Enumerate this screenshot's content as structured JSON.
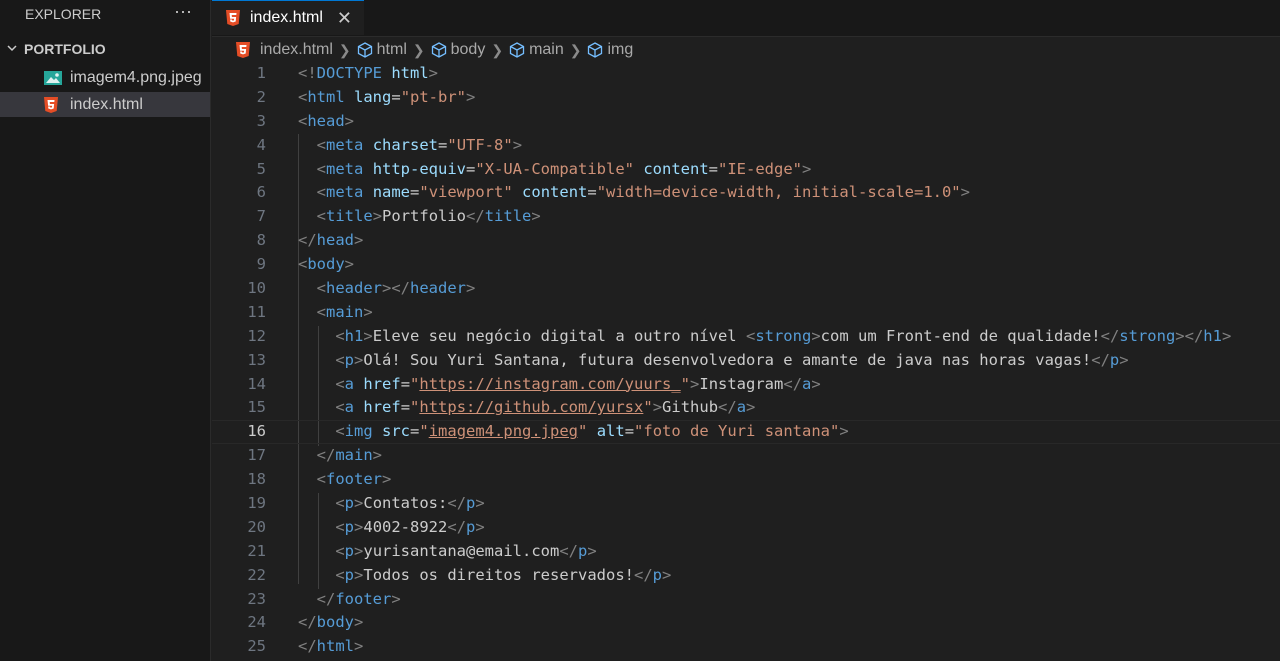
{
  "sidebar": {
    "title": "EXPLORER",
    "more": "···",
    "folder": "PORTFOLIO",
    "files": [
      {
        "name": "imagem4.png.jpeg",
        "icon": "image-file-icon"
      },
      {
        "name": "index.html",
        "icon": "html5-icon",
        "selected": true
      }
    ]
  },
  "tab": {
    "label": "index.html",
    "close": "✕"
  },
  "breadcrumb": [
    "index.html",
    "html",
    "body",
    "main",
    "img"
  ],
  "editor": {
    "current_line": 16,
    "lines": [
      [
        [
          "t-br",
          "<!"
        ],
        [
          "t-tag",
          "DOCTYPE"
        ],
        [
          "t-txt",
          " "
        ],
        [
          "t-attr",
          "html"
        ],
        [
          "t-br",
          ">"
        ]
      ],
      [
        [
          "t-br",
          "<"
        ],
        [
          "t-tag",
          "html"
        ],
        [
          "t-txt",
          " "
        ],
        [
          "t-attr",
          "lang"
        ],
        [
          "t-txt",
          "="
        ],
        [
          "t-str",
          "\"pt-br\""
        ],
        [
          "t-br",
          ">"
        ]
      ],
      [
        [
          "t-br",
          "<"
        ],
        [
          "t-tag",
          "head"
        ],
        [
          "t-br",
          ">"
        ]
      ],
      [
        [
          "t-txt",
          "  "
        ],
        [
          "t-br",
          "<"
        ],
        [
          "t-tag",
          "meta"
        ],
        [
          "t-txt",
          " "
        ],
        [
          "t-attr",
          "charset"
        ],
        [
          "t-txt",
          "="
        ],
        [
          "t-str",
          "\"UTF-8\""
        ],
        [
          "t-br",
          ">"
        ]
      ],
      [
        [
          "t-txt",
          "  "
        ],
        [
          "t-br",
          "<"
        ],
        [
          "t-tag",
          "meta"
        ],
        [
          "t-txt",
          " "
        ],
        [
          "t-attr",
          "http-equiv"
        ],
        [
          "t-txt",
          "="
        ],
        [
          "t-str",
          "\"X-UA-Compatible\""
        ],
        [
          "t-txt",
          " "
        ],
        [
          "t-attr",
          "content"
        ],
        [
          "t-txt",
          "="
        ],
        [
          "t-str",
          "\"IE-edge\""
        ],
        [
          "t-br",
          ">"
        ]
      ],
      [
        [
          "t-txt",
          "  "
        ],
        [
          "t-br",
          "<"
        ],
        [
          "t-tag",
          "meta"
        ],
        [
          "t-txt",
          " "
        ],
        [
          "t-attr",
          "name"
        ],
        [
          "t-txt",
          "="
        ],
        [
          "t-str",
          "\"viewport\""
        ],
        [
          "t-txt",
          " "
        ],
        [
          "t-attr",
          "content"
        ],
        [
          "t-txt",
          "="
        ],
        [
          "t-str",
          "\"width=device-width, initial-scale=1.0\""
        ],
        [
          "t-br",
          ">"
        ]
      ],
      [
        [
          "t-txt",
          "  "
        ],
        [
          "t-br",
          "<"
        ],
        [
          "t-tag",
          "title"
        ],
        [
          "t-br",
          ">"
        ],
        [
          "t-txt",
          "Portfolio"
        ],
        [
          "t-br",
          "</"
        ],
        [
          "t-tag",
          "title"
        ],
        [
          "t-br",
          ">"
        ]
      ],
      [
        [
          "t-br",
          "</"
        ],
        [
          "t-tag",
          "head"
        ],
        [
          "t-br",
          ">"
        ]
      ],
      [
        [
          "t-br",
          "<"
        ],
        [
          "t-tag",
          "body"
        ],
        [
          "t-br",
          ">"
        ]
      ],
      [
        [
          "t-txt",
          "  "
        ],
        [
          "t-br",
          "<"
        ],
        [
          "t-tag",
          "header"
        ],
        [
          "t-br",
          "></"
        ],
        [
          "t-tag",
          "header"
        ],
        [
          "t-br",
          ">"
        ]
      ],
      [
        [
          "t-txt",
          "  "
        ],
        [
          "t-br",
          "<"
        ],
        [
          "t-tag",
          "main"
        ],
        [
          "t-br",
          ">"
        ]
      ],
      [
        [
          "t-txt",
          "    "
        ],
        [
          "t-br",
          "<"
        ],
        [
          "t-tag",
          "h1"
        ],
        [
          "t-br",
          ">"
        ],
        [
          "t-txt",
          "Eleve seu negócio digital a outro nível "
        ],
        [
          "t-br",
          "<"
        ],
        [
          "t-tag",
          "strong"
        ],
        [
          "t-br",
          ">"
        ],
        [
          "t-txt",
          "com um Front-end de qualidade!"
        ],
        [
          "t-br",
          "</"
        ],
        [
          "t-tag",
          "strong"
        ],
        [
          "t-br",
          "></"
        ],
        [
          "t-tag",
          "h1"
        ],
        [
          "t-br",
          ">"
        ]
      ],
      [
        [
          "t-txt",
          "    "
        ],
        [
          "t-br",
          "<"
        ],
        [
          "t-tag",
          "p"
        ],
        [
          "t-br",
          ">"
        ],
        [
          "t-txt",
          "Olá! Sou Yuri Santana, futura desenvolvedora e amante de java nas horas vagas!"
        ],
        [
          "t-br",
          "</"
        ],
        [
          "t-tag",
          "p"
        ],
        [
          "t-br",
          ">"
        ]
      ],
      [
        [
          "t-txt",
          "    "
        ],
        [
          "t-br",
          "<"
        ],
        [
          "t-tag",
          "a"
        ],
        [
          "t-txt",
          " "
        ],
        [
          "t-attr",
          "href"
        ],
        [
          "t-txt",
          "="
        ],
        [
          "t-str",
          "\""
        ],
        [
          "t-link",
          "https://instagram.com/yuurs_"
        ],
        [
          "t-str",
          "\""
        ],
        [
          "t-br",
          ">"
        ],
        [
          "t-txt",
          "Instagram"
        ],
        [
          "t-br",
          "</"
        ],
        [
          "t-tag",
          "a"
        ],
        [
          "t-br",
          ">"
        ]
      ],
      [
        [
          "t-txt",
          "    "
        ],
        [
          "t-br",
          "<"
        ],
        [
          "t-tag",
          "a"
        ],
        [
          "t-txt",
          " "
        ],
        [
          "t-attr",
          "href"
        ],
        [
          "t-txt",
          "="
        ],
        [
          "t-str",
          "\""
        ],
        [
          "t-link",
          "https://github.com/yursx"
        ],
        [
          "t-str",
          "\""
        ],
        [
          "t-br",
          ">"
        ],
        [
          "t-txt",
          "Github"
        ],
        [
          "t-br",
          "</"
        ],
        [
          "t-tag",
          "a"
        ],
        [
          "t-br",
          ">"
        ]
      ],
      [
        [
          "t-txt",
          "    "
        ],
        [
          "t-br",
          "<"
        ],
        [
          "t-tag",
          "img"
        ],
        [
          "t-txt",
          " "
        ],
        [
          "t-attr",
          "src"
        ],
        [
          "t-txt",
          "="
        ],
        [
          "t-str",
          "\""
        ],
        [
          "t-link",
          "imagem4.png.jpeg"
        ],
        [
          "t-str",
          "\""
        ],
        [
          "t-txt",
          " "
        ],
        [
          "t-attr",
          "alt"
        ],
        [
          "t-txt",
          "="
        ],
        [
          "t-str",
          "\"foto de Yuri santana\""
        ],
        [
          "t-br",
          ">"
        ]
      ],
      [
        [
          "t-txt",
          "  "
        ],
        [
          "t-br",
          "</"
        ],
        [
          "t-tag",
          "main"
        ],
        [
          "t-br",
          ">"
        ]
      ],
      [
        [
          "t-txt",
          "  "
        ],
        [
          "t-br",
          "<"
        ],
        [
          "t-tag",
          "footer"
        ],
        [
          "t-br",
          ">"
        ]
      ],
      [
        [
          "t-txt",
          "    "
        ],
        [
          "t-br",
          "<"
        ],
        [
          "t-tag",
          "p"
        ],
        [
          "t-br",
          ">"
        ],
        [
          "t-txt",
          "Contatos:"
        ],
        [
          "t-br",
          "</"
        ],
        [
          "t-tag",
          "p"
        ],
        [
          "t-br",
          ">"
        ]
      ],
      [
        [
          "t-txt",
          "    "
        ],
        [
          "t-br",
          "<"
        ],
        [
          "t-tag",
          "p"
        ],
        [
          "t-br",
          ">"
        ],
        [
          "t-txt",
          "4002-8922"
        ],
        [
          "t-br",
          "</"
        ],
        [
          "t-tag",
          "p"
        ],
        [
          "t-br",
          ">"
        ]
      ],
      [
        [
          "t-txt",
          "    "
        ],
        [
          "t-br",
          "<"
        ],
        [
          "t-tag",
          "p"
        ],
        [
          "t-br",
          ">"
        ],
        [
          "t-txt",
          "yurisantana@email.com"
        ],
        [
          "t-br",
          "</"
        ],
        [
          "t-tag",
          "p"
        ],
        [
          "t-br",
          ">"
        ]
      ],
      [
        [
          "t-txt",
          "    "
        ],
        [
          "t-br",
          "<"
        ],
        [
          "t-tag",
          "p"
        ],
        [
          "t-br",
          ">"
        ],
        [
          "t-txt",
          "Todos os direitos reservados!"
        ],
        [
          "t-br",
          "</"
        ],
        [
          "t-tag",
          "p"
        ],
        [
          "t-br",
          ">"
        ]
      ],
      [
        [
          "t-txt",
          "  "
        ],
        [
          "t-br",
          "</"
        ],
        [
          "t-tag",
          "footer"
        ],
        [
          "t-br",
          ">"
        ]
      ],
      [
        [
          "t-br",
          "</"
        ],
        [
          "t-tag",
          "body"
        ],
        [
          "t-br",
          ">"
        ]
      ],
      [
        [
          "t-br",
          "</"
        ],
        [
          "t-tag",
          "html"
        ],
        [
          "t-br",
          ">"
        ]
      ]
    ]
  }
}
